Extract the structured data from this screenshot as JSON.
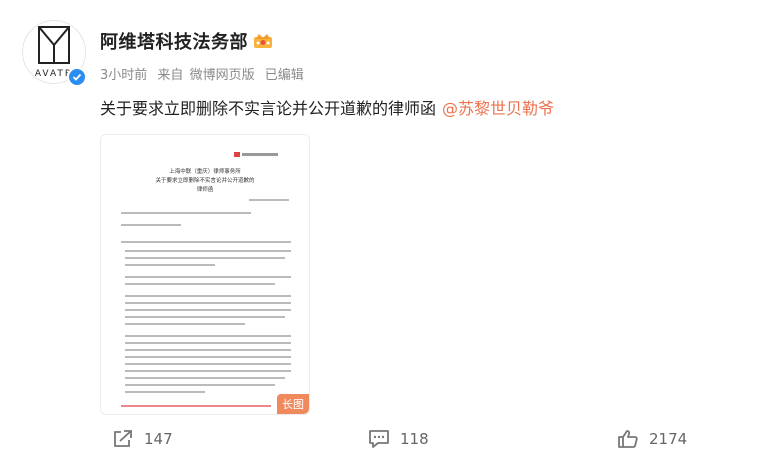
{
  "author": {
    "name": "阿维塔科技法务部",
    "avatar_text": "AVATR",
    "verified_icon": "verified-badge-icon",
    "member_icon": "crown-icon"
  },
  "meta": {
    "time": "3小时前",
    "source_prefix": "来自",
    "source": "微博网页版",
    "edited": "已编辑"
  },
  "post": {
    "text": "关于要求立即删除不实言论并公开道歉的律师函",
    "mention": "@苏黎世贝勒爷"
  },
  "image": {
    "badge": "长图",
    "doc_title_1": "上海中联（重庆）律师事务所",
    "doc_title_2": "关于要求立即删除不实言论并公开道歉的",
    "doc_title_3": "律师函"
  },
  "actions": {
    "repost_count": "147",
    "comment_count": "118",
    "like_count": "2174"
  },
  "colors": {
    "mention": "#eb7350",
    "badge_bg": "#f08a5d",
    "verified": "#2b8df0"
  }
}
